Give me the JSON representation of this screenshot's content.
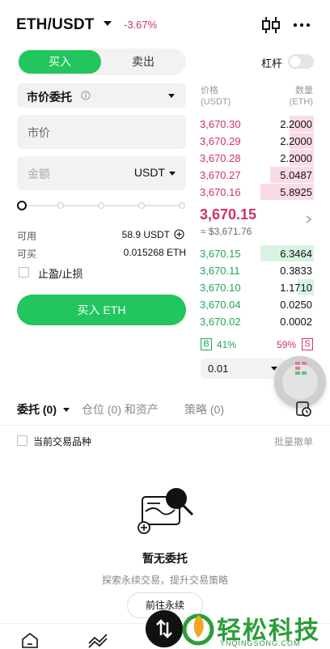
{
  "header": {
    "pair": "ETH/USDT",
    "change": "-3.67%"
  },
  "side_tabs": {
    "buy": "买入",
    "sell": "卖出"
  },
  "leverage": {
    "label": "杠杆",
    "enabled": false
  },
  "order_type": {
    "label": "市价委托"
  },
  "price_field": {
    "value": "市价"
  },
  "amount_field": {
    "placeholder": "金额",
    "unit": "USDT"
  },
  "slider": {
    "percent": 0
  },
  "balances": {
    "available_label": "可用",
    "available_value": "58.9 USDT",
    "can_buy_label": "可买",
    "can_buy_value": "0.015268 ETH"
  },
  "tpsl": {
    "label": "止盈/止损",
    "checked": false
  },
  "buy_button": "买入 ETH",
  "orderbook": {
    "price_header": "价格",
    "price_unit": "(USDT)",
    "qty_header": "数量",
    "qty_unit": "(ETH)",
    "asks": [
      {
        "price": "3,670.30",
        "qty": "2.2000",
        "depth": 0.46
      },
      {
        "price": "3,670.29",
        "qty": "2.2000",
        "depth": 0.46
      },
      {
        "price": "3,670.28",
        "qty": "2.2000",
        "depth": 0.46
      },
      {
        "price": "3,670.27",
        "qty": "5.0487",
        "depth": 0.82
      },
      {
        "price": "3,670.16",
        "qty": "5.8925",
        "depth": 1.0
      }
    ],
    "mid_price": "3,670.15",
    "mid_usd": "≈ $3,671.76",
    "bids": [
      {
        "price": "3,670.15",
        "qty": "6.3464",
        "depth": 1.0
      },
      {
        "price": "3,670.11",
        "qty": "0.3833",
        "depth": 0.0
      },
      {
        "price": "3,670.10",
        "qty": "1.1710",
        "depth": 0.3
      },
      {
        "price": "3,670.04",
        "qty": "0.0250",
        "depth": 0.0
      },
      {
        "price": "3,670.02",
        "qty": "0.0002",
        "depth": 0.0
      }
    ],
    "buy_ratio_label": "B",
    "buy_ratio": "41%",
    "sell_ratio": "59%",
    "sell_ratio_label": "S",
    "depth_step": "0.01"
  },
  "bottom_tabs": {
    "orders": "委托 (0)",
    "positions": "仓位 (0) 和资产",
    "strategy": "策略 (0)"
  },
  "filter": {
    "current_only": "当前交易品种",
    "batch_cancel": "批量撤单"
  },
  "empty_state": {
    "title": "暂无委托",
    "subtitle": "探索永续交易，提升交易策略",
    "button": "前往永续"
  },
  "watermark": {
    "text": "轻松科技",
    "sub": "YNQINGSONG.COM"
  },
  "colors": {
    "buy_green": "#22c55e",
    "sell_red": "#d0306a",
    "ask_bg": "#fadbe5",
    "bid_bg": "#d8f3e1"
  }
}
